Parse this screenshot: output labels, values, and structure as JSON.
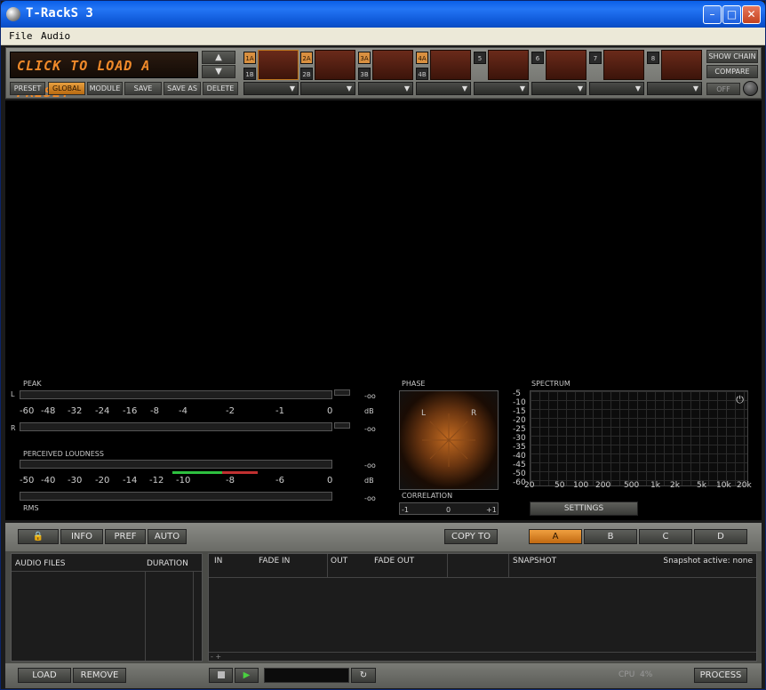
{
  "window": {
    "title": "T-RackS 3"
  },
  "menu": {
    "file": "File",
    "audio": "Audio"
  },
  "preset": {
    "display": "CLICK TO LOAD A PRESET",
    "buttons": [
      "PRESET",
      "GLOBAL",
      "MODULE",
      "SAVE",
      "SAVE AS",
      "DELETE"
    ],
    "up": "▲",
    "down": "▼"
  },
  "slots": [
    {
      "a": "1A",
      "b": "1B"
    },
    {
      "a": "2A",
      "b": "2B"
    },
    {
      "a": "3A",
      "b": "3B"
    },
    {
      "a": "4A",
      "b": "4B"
    },
    {
      "a": "5",
      "b": ""
    },
    {
      "a": "6",
      "b": ""
    },
    {
      "a": "7",
      "b": ""
    },
    {
      "a": "8",
      "b": ""
    }
  ],
  "chain": {
    "show_chain": "SHOW CHAIN",
    "compare": "COMPARE",
    "off": "OFF"
  },
  "meters": {
    "peak": "PEAK",
    "l": "L",
    "r": "R",
    "db": "dB",
    "neg_inf": "-oo",
    "peak_scale": [
      "-60",
      "-48",
      "-32",
      "-24",
      "-16",
      "-8",
      "-4",
      "-2",
      "-1",
      "0"
    ],
    "loudness": "PERCEIVED LOUDNESS",
    "loud_scale": [
      "-50",
      "-40",
      "-30",
      "-20",
      "-14",
      "-12",
      "-10",
      "-8",
      "-6",
      "0"
    ],
    "rms": "RMS"
  },
  "phase": {
    "title": "PHASE",
    "l": "L",
    "r": "R"
  },
  "correlation": {
    "title": "CORRELATION",
    "min": "-1",
    "mid": "0",
    "max": "+1"
  },
  "spectrum": {
    "title": "SPECTRUM",
    "y": [
      "-5",
      "-10",
      "-15",
      "-20",
      "-25",
      "-30",
      "-35",
      "-40",
      "-45",
      "-50",
      "-60"
    ],
    "x": [
      "20",
      "50",
      "100",
      "200",
      "500",
      "1k",
      "2k",
      "5k",
      "10k",
      "20k"
    ],
    "settings": "SETTINGS"
  },
  "toolbar": {
    "info": "INFO",
    "pref": "PREF",
    "auto": "AUTO",
    "copy_to": "COPY TO",
    "a": "A",
    "b": "B",
    "c": "C",
    "d": "D"
  },
  "files": {
    "audio_files": "AUDIO FILES",
    "duration": "DURATION"
  },
  "tracks": {
    "in": "IN",
    "fade_in": "FADE IN",
    "out": "OUT",
    "fade_out": "FADE OUT",
    "snapshot": "SNAPSHOT",
    "snapshot_status": "Snapshot active: none",
    "corner": "- +"
  },
  "bottom": {
    "load": "LOAD",
    "remove": "REMOVE",
    "cpu": "CPU",
    "cpu_value": "4%",
    "process": "PROCESS"
  },
  "colors": {
    "accent": "#e8a040",
    "preset_text": "#f08a2a"
  }
}
